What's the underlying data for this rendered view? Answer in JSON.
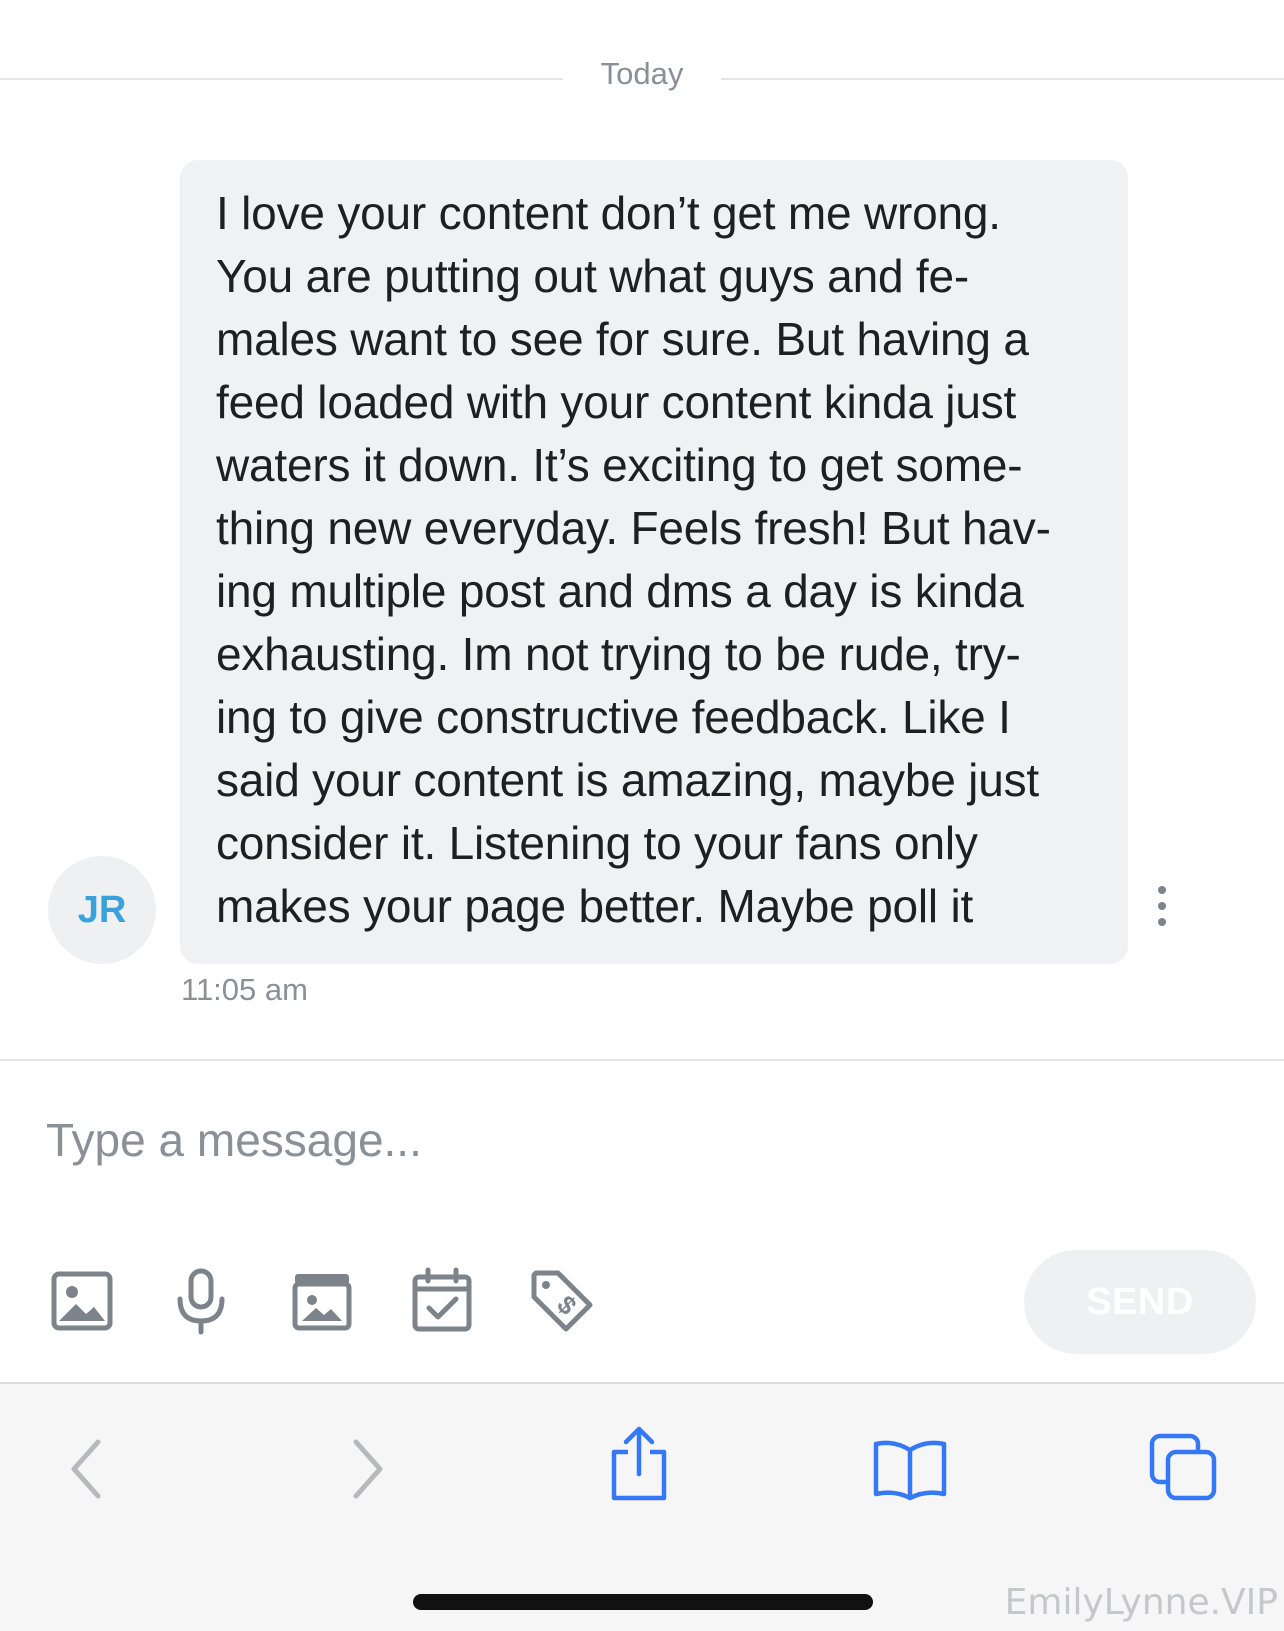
{
  "chat": {
    "date_label": "Today",
    "message": {
      "sender_initials": "JR",
      "text": "I love your content don’t get me wrong.\nYou are putting out what guys and fe-\nmales want to see for sure. But having a\nfeed loaded with your content kinda just\nwaters it down. It’s exciting to get some-\nthing new everyday. Feels fresh! But hav-\ning multiple post and dms a day is kinda\nexhausting. Im not trying to be rude, try-\ning to give constructive feedback. Like I\nsaid your content is amazing, maybe just\nconsider it. Listening to your fans only\nmakes your page better. Maybe poll it",
      "time": "11:05 am"
    }
  },
  "composer": {
    "placeholder": "Type a message...",
    "send_label": "SEND",
    "tools": [
      "image-icon",
      "microphone-icon",
      "media-vault-icon",
      "schedule-icon",
      "price-tag-icon"
    ]
  },
  "browser_toolbar": {
    "items": [
      "back-icon",
      "forward-icon",
      "share-icon",
      "bookmarks-icon",
      "tabs-icon"
    ]
  },
  "watermark": "EmilyLynne.VIP",
  "colors": {
    "accent": "#3aa2d8",
    "ios_blue": "#3478f6",
    "bubble": "#f0f1f3",
    "muted_text": "#8a9096"
  }
}
